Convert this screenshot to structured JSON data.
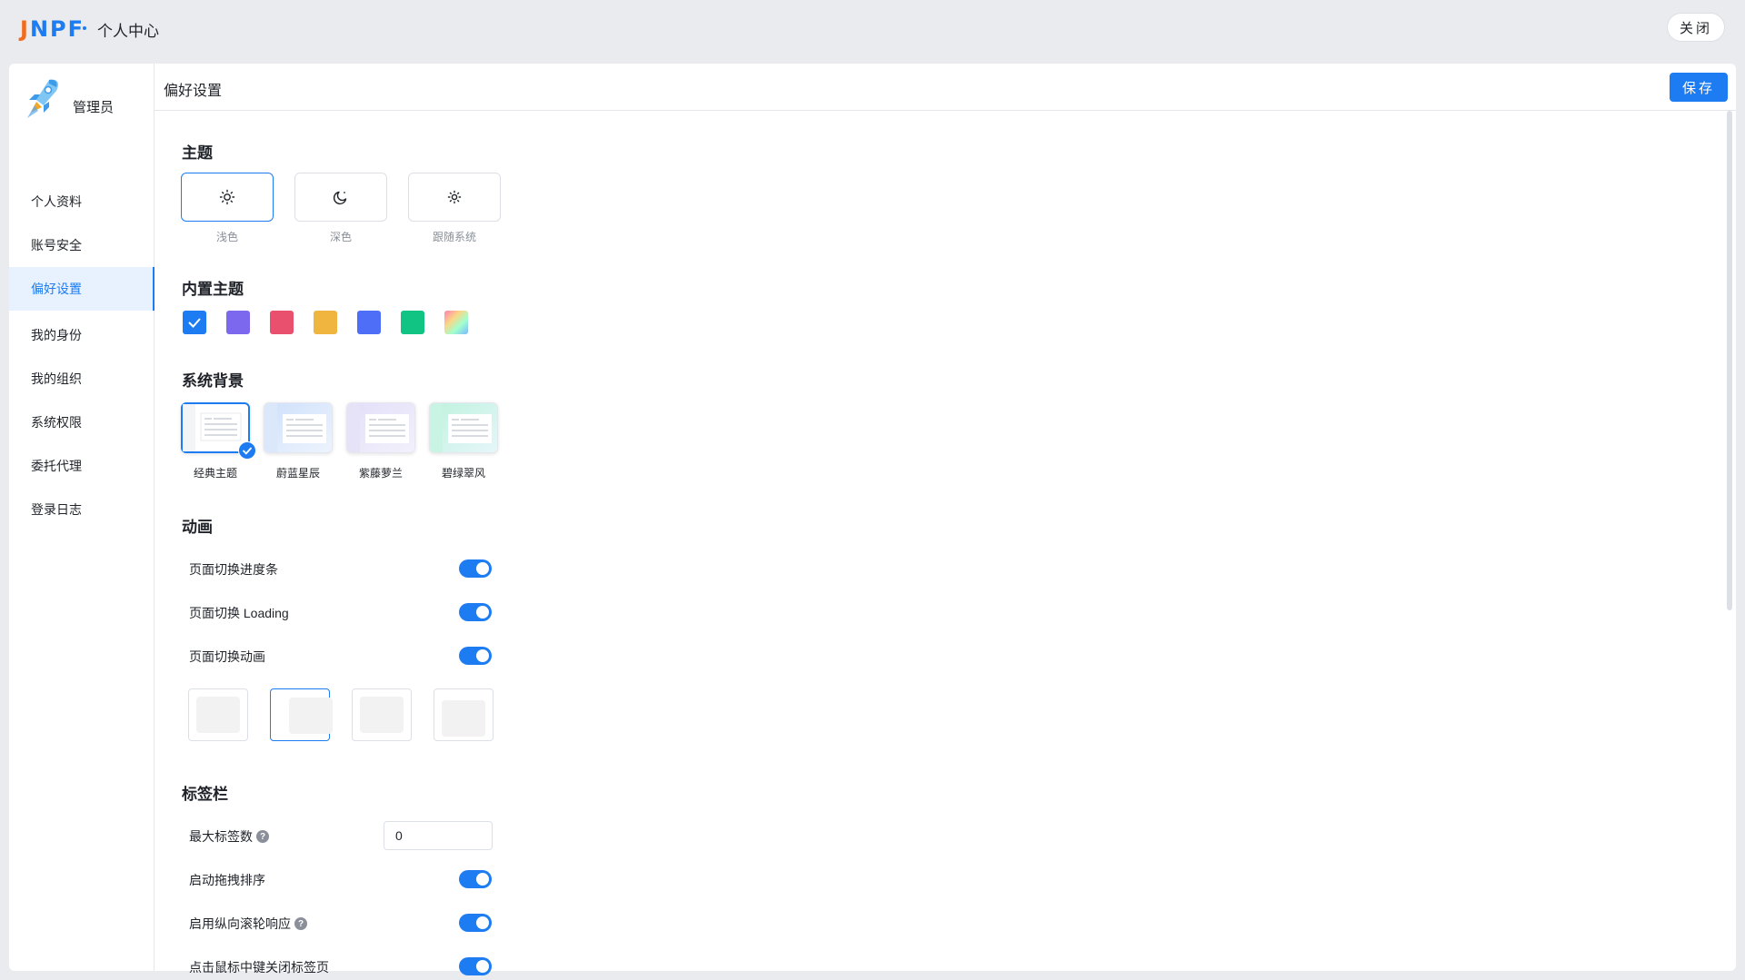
{
  "topbar": {
    "logo": "JNPF",
    "title": "个人中心",
    "close_label": "关闭"
  },
  "sidebar": {
    "user_name": "管理员",
    "items": [
      {
        "label": "个人资料"
      },
      {
        "label": "账号安全"
      },
      {
        "label": "偏好设置",
        "active": true
      },
      {
        "label": "我的身份"
      },
      {
        "label": "我的组织"
      },
      {
        "label": "系统权限"
      },
      {
        "label": "委托代理"
      },
      {
        "label": "登录日志"
      }
    ]
  },
  "main": {
    "title": "偏好设置",
    "save_label": "保存",
    "theme": {
      "title": "主题",
      "modes": [
        {
          "label": "浅色",
          "icon": "sun-icon",
          "selected": true
        },
        {
          "label": "深色",
          "icon": "moon-icon",
          "selected": false
        },
        {
          "label": "跟随系统",
          "icon": "sun-small-icon",
          "selected": false
        }
      ]
    },
    "builtin_theme": {
      "title": "内置主题",
      "colors": [
        "#1d7cf2",
        "#7b68ee",
        "#e8506e",
        "#f0b53f",
        "#4f6ef7",
        "#11c483",
        "gradient"
      ],
      "selected_index": 0
    },
    "background": {
      "title": "系统背景",
      "options": [
        {
          "label": "经典主题",
          "selected": true
        },
        {
          "label": "蔚蓝星辰",
          "selected": false
        },
        {
          "label": "紫藤萝兰",
          "selected": false
        },
        {
          "label": "碧绿翠风",
          "selected": false
        }
      ]
    },
    "animation": {
      "title": "动画",
      "toggles": [
        {
          "label": "页面切换进度条",
          "on": true
        },
        {
          "label": "页面切换 Loading",
          "on": true
        },
        {
          "label": "页面切换动画",
          "on": true
        }
      ],
      "style_selected_index": 1
    },
    "tabbar": {
      "title": "标签栏",
      "max_tabs_label": "最大标签数",
      "max_tabs_value": "0",
      "toggles": [
        {
          "label": "启动拖拽排序",
          "on": true
        },
        {
          "label": "启用纵向滚轮响应",
          "on": true,
          "help": true
        },
        {
          "label": "点击鼠标中键关闭标签页",
          "on": true
        }
      ]
    }
  }
}
